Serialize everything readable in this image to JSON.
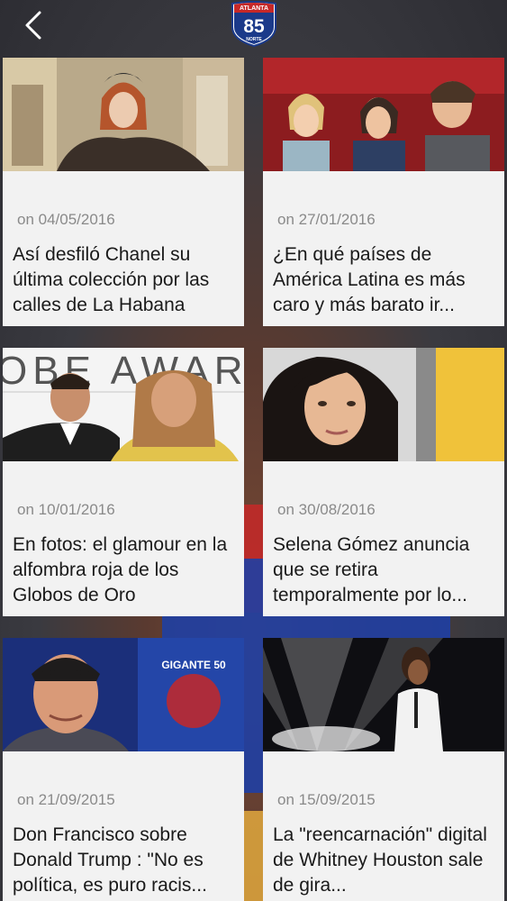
{
  "header": {
    "logo_top": "ATLANTA",
    "logo_number": "85",
    "logo_bottom": "NORTE"
  },
  "articles": [
    {
      "date": "on 04/05/2016",
      "title": "Así desfiló Chanel su última colección por las calles de La Habana"
    },
    {
      "date": "on 27/01/2016",
      "title": "¿En qué países de América Latina es más caro y más barato ir..."
    },
    {
      "date": "on 10/01/2016",
      "title": "En fotos: el glamour en la alfombra roja de los Globos de Oro"
    },
    {
      "date": "on 30/08/2016",
      "title": "Selena Gómez anuncia que se retira temporalmente por lo..."
    },
    {
      "date": "on 21/09/2015",
      "title": "Don Francisco sobre Donald Trump : \"No es política, es puro racis..."
    },
    {
      "date": "on 15/09/2015",
      "title": "La \"reencarnación\" digital de Whitney Houston sale de gira..."
    }
  ],
  "thumbnails": {
    "a3_backdrop": "GLOBE AWARDS",
    "a5_sign": "GIGANTE 50"
  }
}
